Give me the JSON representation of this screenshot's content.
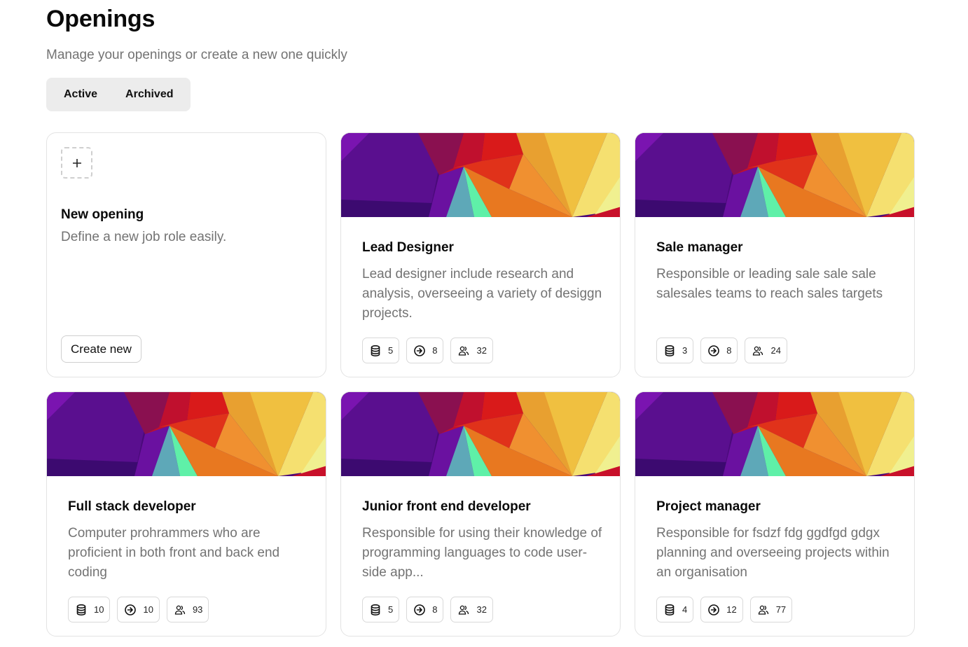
{
  "header": {
    "title": "Openings",
    "subtitle": "Manage your openings or create a new one quickly"
  },
  "tabs": [
    {
      "label": "Active",
      "selected": true
    },
    {
      "label": "Archived",
      "selected": false
    }
  ],
  "new_opening": {
    "icon": "plus-icon",
    "title": "New opening",
    "description": "Define a new job role easily.",
    "button_label": "Create new"
  },
  "stat_icons": [
    "database-icon",
    "arrow-right-circle-icon",
    "users-icon"
  ],
  "openings": [
    {
      "title": "Lead Designer",
      "description": "Lead designer include research and analysis, overseeing a variety of desiggn projects.",
      "stats": [
        "5",
        "8",
        "32"
      ]
    },
    {
      "title": "Sale manager",
      "description": "Responsible or leading sale sale sale salesales teams to reach sales targets",
      "stats": [
        "3",
        "8",
        "24"
      ]
    },
    {
      "title": "Full stack developer",
      "description": "Computer prohrammers who are proficient in both front and back end coding",
      "stats": [
        "10",
        "10",
        "93"
      ]
    },
    {
      "title": "Junior front end developer",
      "description": "Responsible for using their knowledge of programming languages to code user-side app...",
      "stats": [
        "5",
        "8",
        "32"
      ]
    },
    {
      "title": "Project manager",
      "description": "Responsible for fsdzf fdg ggdfgd gdgx planning and overseeing projects within an organisation",
      "stats": [
        "4",
        "12",
        "77"
      ]
    }
  ]
}
